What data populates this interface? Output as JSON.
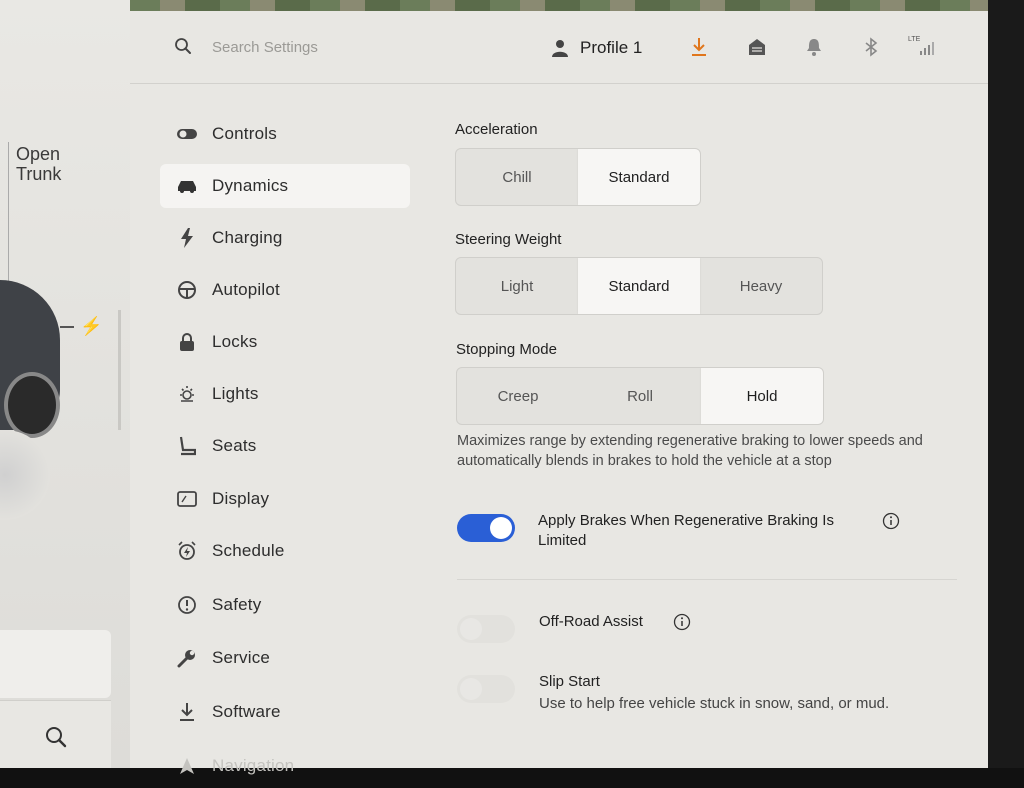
{
  "car_pane": {
    "open_trunk_line1": "Open",
    "open_trunk_line2": "Trunk"
  },
  "header": {
    "search_placeholder": "Search Settings",
    "profile_label": "Profile 1",
    "lte_label": "LTE",
    "download_color": "#e0761c"
  },
  "sidebar": {
    "items": [
      {
        "label": "Controls",
        "icon": "toggle-icon"
      },
      {
        "label": "Dynamics",
        "icon": "car-icon",
        "active": true
      },
      {
        "label": "Charging",
        "icon": "bolt-icon"
      },
      {
        "label": "Autopilot",
        "icon": "steering-wheel-icon"
      },
      {
        "label": "Locks",
        "icon": "lock-icon"
      },
      {
        "label": "Lights",
        "icon": "light-icon"
      },
      {
        "label": "Seats",
        "icon": "seat-icon"
      },
      {
        "label": "Display",
        "icon": "display-icon"
      },
      {
        "label": "Schedule",
        "icon": "schedule-icon"
      },
      {
        "label": "Safety",
        "icon": "safety-icon"
      },
      {
        "label": "Service",
        "icon": "wrench-icon"
      },
      {
        "label": "Software",
        "icon": "download-icon"
      },
      {
        "label": "Navigation",
        "icon": "navigation-icon"
      }
    ]
  },
  "dynamics": {
    "acceleration": {
      "title": "Acceleration",
      "options": [
        "Chill",
        "Standard"
      ],
      "selected": "Standard"
    },
    "steering_weight": {
      "title": "Steering Weight",
      "options": [
        "Light",
        "Standard",
        "Heavy"
      ],
      "selected": "Standard"
    },
    "stopping_mode": {
      "title": "Stopping Mode",
      "options": [
        "Creep",
        "Roll",
        "Hold"
      ],
      "selected": "Hold",
      "description": "Maximizes range by extending regenerative braking to lower speeds and automatically blends in brakes to hold the vehicle at a stop"
    },
    "apply_brakes": {
      "label_line1": "Apply Brakes When Regenerative Braking Is",
      "label_line2": "Limited",
      "enabled": true
    },
    "off_road_assist": {
      "label": "Off-Road Assist",
      "enabled": false
    },
    "slip_start": {
      "label": "Slip Start",
      "description": "Use to help free vehicle stuck in snow, sand, or mud.",
      "enabled": false
    }
  },
  "colors": {
    "toggle_on": "#2a5fd6",
    "panel_bg": "#e8e7e3"
  }
}
